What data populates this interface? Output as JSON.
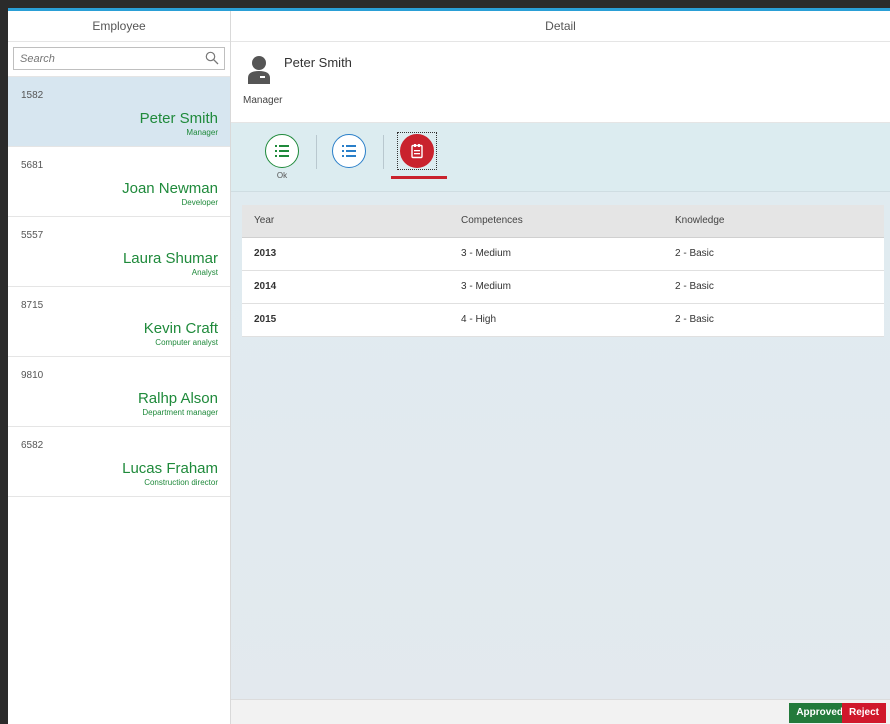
{
  "master": {
    "header": "Employee",
    "search_placeholder": "Search",
    "employees": [
      {
        "id": "1582",
        "name": "Peter Smith",
        "role": "Manager",
        "selected": true
      },
      {
        "id": "5681",
        "name": "Joan Newman",
        "role": "Developer"
      },
      {
        "id": "5557",
        "name": "Laura Shumar",
        "role": "Analyst"
      },
      {
        "id": "8715",
        "name": "Kevin Craft",
        "role": "Computer analyst"
      },
      {
        "id": "9810",
        "name": "Ralhp Alson",
        "role": "Department manager"
      },
      {
        "id": "6582",
        "name": "Lucas Fraham",
        "role": "Construction director"
      }
    ]
  },
  "detail": {
    "header": "Detail",
    "object_title": "Peter Smith",
    "object_subtitle": "Manager",
    "tabs": [
      {
        "icon": "list-icon",
        "label": "Ok",
        "color": "#1f8a3b"
      },
      {
        "icon": "list-icon",
        "label": "",
        "color": "#2a7fc9"
      },
      {
        "icon": "notepad-icon",
        "label": "",
        "color": "#c9222d",
        "selected": true
      }
    ],
    "table": {
      "columns": [
        "Year",
        "Competences",
        "Knowledge"
      ],
      "rows": [
        [
          "2013",
          "3 - Medium",
          "2 - Basic"
        ],
        [
          "2014",
          "3 - Medium",
          "2 - Basic"
        ],
        [
          "2015",
          "4 - High",
          "2 - Basic"
        ]
      ]
    },
    "footer": {
      "approve_label": "Approved",
      "reject_label": "Reject"
    }
  },
  "colors": {
    "accent_green": "#1f8a3b",
    "accent_blue": "#2a7fc9",
    "accent_red": "#c9222d",
    "selection": "#d7e6f0"
  }
}
